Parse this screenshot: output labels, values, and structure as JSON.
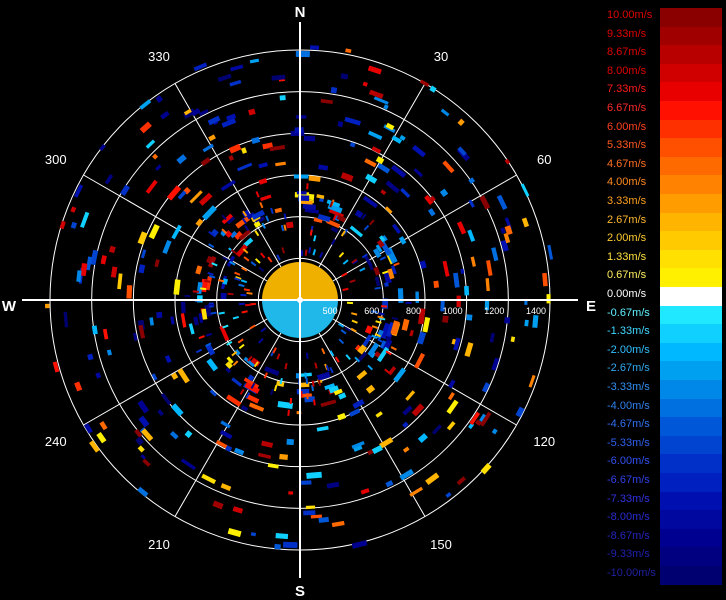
{
  "compass": {
    "north": "N",
    "south": "S",
    "east": "E",
    "west": "W"
  },
  "bearings": [
    {
      "deg": 30,
      "label": "30"
    },
    {
      "deg": 60,
      "label": "60"
    },
    {
      "deg": 120,
      "label": "120"
    },
    {
      "deg": 150,
      "label": "150"
    },
    {
      "deg": 210,
      "label": "210"
    },
    {
      "deg": 240,
      "label": "240"
    },
    {
      "deg": 300,
      "label": "300"
    },
    {
      "deg": 330,
      "label": "330"
    }
  ],
  "range_labels": [
    "500",
    "600",
    "800",
    "1000",
    "1200",
    "1400"
  ],
  "legend": [
    {
      "label": "10.00m/s",
      "color": "#8a0000",
      "text_color": "#e00000"
    },
    {
      "label": "9.33m/s",
      "color": "#a00000",
      "text_color": "#e00000"
    },
    {
      "label": "8.67m/s",
      "color": "#b80000",
      "text_color": "#e00000"
    },
    {
      "label": "8.00m/s",
      "color": "#d00000",
      "text_color": "#e00000"
    },
    {
      "label": "7.33m/s",
      "color": "#e80000",
      "text_color": "#ff1a1a"
    },
    {
      "label": "6.67m/s",
      "color": "#ff1000",
      "text_color": "#ff2a2a"
    },
    {
      "label": "6.00m/s",
      "color": "#ff3000",
      "text_color": "#ff4020"
    },
    {
      "label": "5.33m/s",
      "color": "#ff5000",
      "text_color": "#ff5a20"
    },
    {
      "label": "4.67m/s",
      "color": "#ff6a00",
      "text_color": "#ff7020"
    },
    {
      "label": "4.00m/s",
      "color": "#ff8200",
      "text_color": "#ff8a20"
    },
    {
      "label": "3.33m/s",
      "color": "#ff9c00",
      "text_color": "#ffa020"
    },
    {
      "label": "2.67m/s",
      "color": "#ffb400",
      "text_color": "#ffb830"
    },
    {
      "label": "2.00m/s",
      "color": "#ffca00",
      "text_color": "#ffcc30"
    },
    {
      "label": "1.33m/s",
      "color": "#ffe000",
      "text_color": "#ffe040"
    },
    {
      "label": "0.67m/s",
      "color": "#fff000",
      "text_color": "#fff060"
    },
    {
      "label": "0.00m/s",
      "color": "#ffffff",
      "text_color": "#ffffff"
    },
    {
      "label": "-0.67m/s",
      "color": "#20e8ff",
      "text_color": "#60f0ff"
    },
    {
      "label": "-1.33m/s",
      "color": "#10d0ff",
      "text_color": "#40d8ff"
    },
    {
      "label": "-2.00m/s",
      "color": "#00b8ff",
      "text_color": "#30c0ff"
    },
    {
      "label": "-2.67m/s",
      "color": "#00a0f0",
      "text_color": "#30a8f0"
    },
    {
      "label": "-3.33m/s",
      "color": "#0088e8",
      "text_color": "#3090f0"
    },
    {
      "label": "-4.00m/s",
      "color": "#0070e0",
      "text_color": "#3080f0"
    },
    {
      "label": "-4.67m/s",
      "color": "#0058d8",
      "text_color": "#3070f0"
    },
    {
      "label": "-5.33m/s",
      "color": "#0044d0",
      "text_color": "#3060f0"
    },
    {
      "label": "-6.00m/s",
      "color": "#0030c8",
      "text_color": "#3050f0"
    },
    {
      "label": "-6.67m/s",
      "color": "#0020c0",
      "text_color": "#3040e8"
    },
    {
      "label": "-7.33m/s",
      "color": "#0010b0",
      "text_color": "#3030e0"
    },
    {
      "label": "-8.00m/s",
      "color": "#0008a0",
      "text_color": "#2a2ad0"
    },
    {
      "label": "-8.67m/s",
      "color": "#000090",
      "text_color": "#2424c0"
    },
    {
      "label": "-9.33m/s",
      "color": "#000080",
      "text_color": "#2020b0"
    },
    {
      "label": "-10.00m/s",
      "color": "#000070",
      "text_color": "#2020a0"
    }
  ],
  "colors": {
    "grid": "#ffffff",
    "background": "#000000"
  }
}
